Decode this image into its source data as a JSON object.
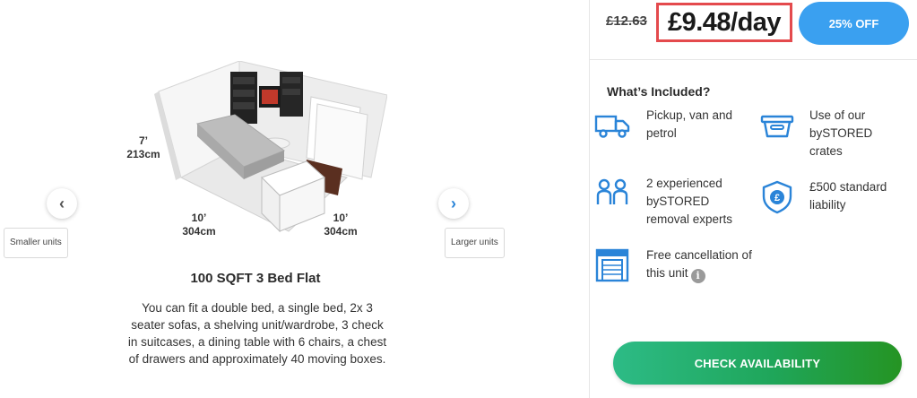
{
  "unit": {
    "dimensions": {
      "height_ft": "7’",
      "height_cm": "213cm",
      "length_ft": "10’",
      "length_cm": "304cm",
      "width_ft": "10’",
      "width_cm": "304cm"
    },
    "prev_label": "Smaller units",
    "next_label": "Larger units",
    "title": "100 SQFT 3 Bed Flat",
    "description": "You can fit a double bed, a single bed, 2x 3 seater sofas, a shelving unit/wardrobe, 3 check in suitcases, a dining table with 6 chairs, a chest of drawers and approximately 40 moving boxes."
  },
  "pricing": {
    "old_price": "£12.63",
    "price": "£9.48/day",
    "discount_label": "25% OFF"
  },
  "included": {
    "title": "What’s Included?",
    "features": [
      {
        "icon": "truck-icon",
        "text": "Pickup, van and petrol"
      },
      {
        "icon": "crate-icon",
        "text": "Use of our bySTORED crates"
      },
      {
        "icon": "people-icon",
        "text": "2 experienced bySTORED removal experts"
      },
      {
        "icon": "shield-pound-icon",
        "text": "£500 standard liability"
      },
      {
        "icon": "storage-unit-icon",
        "text": "Free cancellation of this unit"
      }
    ]
  },
  "cta": {
    "label": "CHECK AVAILABILITY"
  },
  "colors": {
    "accent_blue": "#3aa0f0",
    "icon_blue": "#2a84d8",
    "price_highlight": "#e44a4d",
    "cta_green": "#1fa65a"
  }
}
